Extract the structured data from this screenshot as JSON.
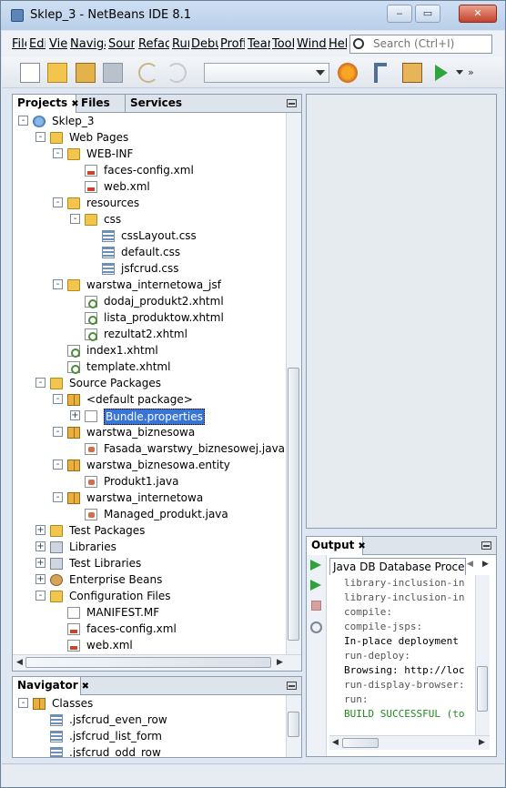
{
  "window": {
    "title": "Sklep_3 - NetBeans IDE 8.1",
    "buttons": {
      "minimize": "‒",
      "maximize": "▭",
      "close": "✕"
    }
  },
  "menu": [
    "File",
    "Edit",
    "View",
    "Navigate",
    "Source",
    "Refactor",
    "Run",
    "Debug",
    "Profile",
    "Team",
    "Tools",
    "Window",
    "Help"
  ],
  "search": {
    "placeholder": "Search (Ctrl+I)"
  },
  "toolbar": {
    "config_value": ""
  },
  "projects_panel": {
    "tabs": [
      "Projects",
      "Files",
      "Services"
    ],
    "close_glyph": "✖",
    "tree": [
      {
        "label": "Sklep_3",
        "icon": "web-project-icon",
        "toggle": "-"
      },
      {
        "label": "Web Pages",
        "icon": "folder-icon",
        "toggle": "-"
      },
      {
        "label": "WEB-INF",
        "icon": "folder-icon",
        "toggle": "-"
      },
      {
        "label": "faces-config.xml",
        "icon": "xml-file-icon",
        "toggle": ""
      },
      {
        "label": "web.xml",
        "icon": "xml-file-icon",
        "toggle": ""
      },
      {
        "label": "resources",
        "icon": "folder-icon",
        "toggle": "-"
      },
      {
        "label": "css",
        "icon": "folder-icon",
        "toggle": "-"
      },
      {
        "label": "cssLayout.css",
        "icon": "css-file-icon",
        "toggle": ""
      },
      {
        "label": "default.css",
        "icon": "css-file-icon",
        "toggle": ""
      },
      {
        "label": "jsfcrud.css",
        "icon": "css-file-icon",
        "toggle": ""
      },
      {
        "label": "warstwa_internetowa_jsf",
        "icon": "folder-icon",
        "toggle": "-"
      },
      {
        "label": "dodaj_produkt2.xhtml",
        "icon": "xhtml-file-icon",
        "toggle": ""
      },
      {
        "label": "lista_produktow.xhtml",
        "icon": "xhtml-file-icon",
        "toggle": ""
      },
      {
        "label": "rezultat2.xhtml",
        "icon": "xhtml-file-icon",
        "toggle": ""
      },
      {
        "label": "index1.xhtml",
        "icon": "xhtml-file-icon",
        "toggle": ""
      },
      {
        "label": "template.xhtml",
        "icon": "xhtml-file-icon",
        "toggle": ""
      },
      {
        "label": "Source Packages",
        "icon": "folder-icon",
        "toggle": "-"
      },
      {
        "label": "<default package>",
        "icon": "package-icon",
        "toggle": "-"
      },
      {
        "label": "Bundle.properties",
        "icon": "properties-file-icon",
        "toggle": "+",
        "selected": true
      },
      {
        "label": "warstwa_biznesowa",
        "icon": "package-icon",
        "toggle": "-"
      },
      {
        "label": "Fasada_warstwy_biznesowej.java",
        "icon": "java-file-icon",
        "toggle": ""
      },
      {
        "label": "warstwa_biznesowa.entity",
        "icon": "package-icon",
        "toggle": "-"
      },
      {
        "label": "Produkt1.java",
        "icon": "java-file-icon",
        "toggle": ""
      },
      {
        "label": "warstwa_internetowa",
        "icon": "package-icon",
        "toggle": "-"
      },
      {
        "label": "Managed_produkt.java",
        "icon": "java-file-icon",
        "toggle": ""
      },
      {
        "label": "Test Packages",
        "icon": "folder-icon",
        "toggle": "+"
      },
      {
        "label": "Libraries",
        "icon": "library-icon",
        "toggle": "+"
      },
      {
        "label": "Test Libraries",
        "icon": "library-icon",
        "toggle": "+"
      },
      {
        "label": "Enterprise Beans",
        "icon": "bean-icon",
        "toggle": "+"
      },
      {
        "label": "Configuration Files",
        "icon": "folder-icon",
        "toggle": "-"
      },
      {
        "label": "MANIFEST.MF",
        "icon": "manifest-file-icon",
        "toggle": ""
      },
      {
        "label": "faces-config.xml",
        "icon": "xml-file-icon",
        "toggle": ""
      },
      {
        "label": "web.xml",
        "icon": "xml-file-icon",
        "toggle": ""
      }
    ]
  },
  "navigator": {
    "title": "Navigator",
    "close_glyph": "✖",
    "tree": [
      {
        "label": "Classes",
        "icon": "package-icon",
        "toggle": "-"
      },
      {
        "label": ".jsfcrud_even_row",
        "icon": "css-file-icon",
        "toggle": ""
      },
      {
        "label": ".jsfcrud_list_form",
        "icon": "css-file-icon",
        "toggle": ""
      },
      {
        "label": ".jsfcrud_odd_row",
        "icon": "css-file-icon",
        "toggle": ""
      }
    ]
  },
  "output": {
    "title": "Output",
    "close_glyph": "✖",
    "subtab": "Java DB Database Proces...",
    "lines": [
      {
        "text": "library-inclusion-in",
        "color": "#555555"
      },
      {
        "text": "library-inclusion-in",
        "color": "#555555"
      },
      {
        "text": "compile:",
        "color": "#555555"
      },
      {
        "text": "compile-jsps:",
        "color": "#555555"
      },
      {
        "text": "In-place deployment",
        "color": "#000000"
      },
      {
        "text": "run-deploy:",
        "color": "#555555"
      },
      {
        "text": "Browsing: http://loc",
        "color": "#000000"
      },
      {
        "text": "run-display-browser:",
        "color": "#555555"
      },
      {
        "text": "run:",
        "color": "#555555"
      },
      {
        "text": "BUILD SUCCESSFUL (to",
        "color": "#1f8a1f"
      }
    ]
  }
}
